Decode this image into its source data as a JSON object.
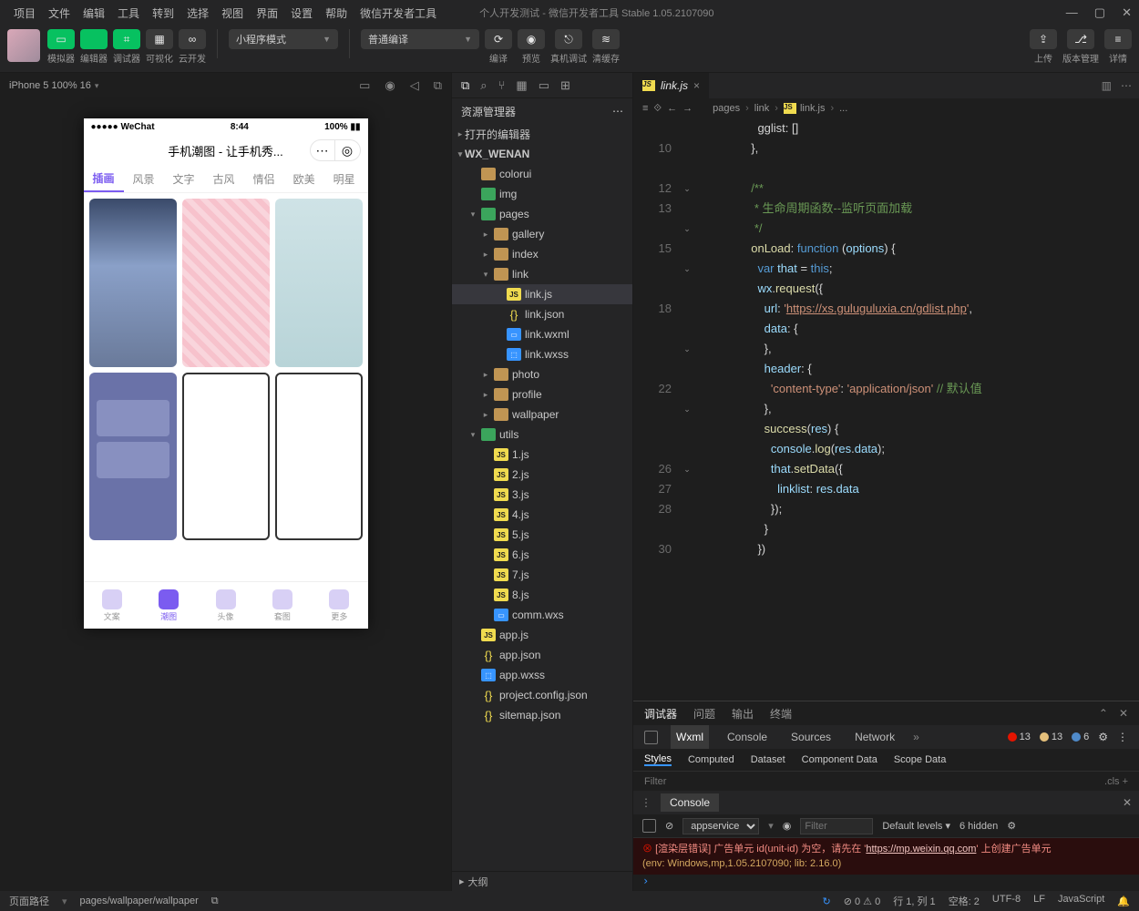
{
  "menubar": [
    "项目",
    "文件",
    "编辑",
    "工具",
    "转到",
    "选择",
    "视图",
    "界面",
    "设置",
    "帮助",
    "微信开发者工具"
  ],
  "window_title": "个人开发测试 - 微信开发者工具 Stable 1.05.2107090",
  "toolbar": {
    "groups": [
      {
        "label": "模拟器",
        "cls": "green",
        "glyph": "▭"
      },
      {
        "label": "编辑器",
        "cls": "green",
        "glyph": "</>"
      },
      {
        "label": "调试器",
        "cls": "green",
        "glyph": "⌗"
      },
      {
        "label": "可视化",
        "cls": "dark",
        "glyph": "▦"
      },
      {
        "label": "云开发",
        "cls": "dark",
        "glyph": "∞"
      }
    ],
    "mode": "小程序模式",
    "compile": "普通编译",
    "actions": [
      {
        "label": "编译",
        "glyph": "⟳"
      },
      {
        "label": "预览",
        "glyph": "◉"
      },
      {
        "label": "真机调试",
        "glyph": "⎋"
      },
      {
        "label": "清缓存",
        "glyph": "≋"
      }
    ],
    "right": [
      {
        "label": "上传",
        "glyph": "⇪"
      },
      {
        "label": "版本管理",
        "glyph": "⎇"
      },
      {
        "label": "详情",
        "glyph": "≡"
      }
    ]
  },
  "simulator": {
    "device": "iPhone 5 100% 16"
  },
  "phone": {
    "carrier": "●●●●● WeChat",
    "time": "8:44",
    "battery": "100%",
    "title": "手机潮图 - 让手机秀...",
    "tabs": [
      "插画",
      "风景",
      "文字",
      "古风",
      "情侣",
      "欧美",
      "明星"
    ],
    "tabbar": [
      "文案",
      "潮图",
      "头像",
      "套图",
      "更多"
    ],
    "tabbar_active": 1
  },
  "explorer": {
    "title": "资源管理器",
    "sections": [
      "打开的编辑器",
      "WX_WENAN"
    ],
    "tree": [
      {
        "d": 1,
        "t": "folder",
        "n": "colorui",
        "c": ""
      },
      {
        "d": 1,
        "t": "folder-g",
        "n": "img",
        "c": ""
      },
      {
        "d": 1,
        "t": "folder-g",
        "n": "pages",
        "c": "▾"
      },
      {
        "d": 2,
        "t": "folder",
        "n": "gallery",
        "c": "▸"
      },
      {
        "d": 2,
        "t": "folder",
        "n": "index",
        "c": "▸"
      },
      {
        "d": 2,
        "t": "folder",
        "n": "link",
        "c": "▾"
      },
      {
        "d": 3,
        "t": "js",
        "n": "link.js",
        "c": "",
        "sel": true
      },
      {
        "d": 3,
        "t": "json",
        "n": "link.json",
        "c": ""
      },
      {
        "d": 3,
        "t": "wxml",
        "n": "link.wxml",
        "c": ""
      },
      {
        "d": 3,
        "t": "wxss",
        "n": "link.wxss",
        "c": ""
      },
      {
        "d": 2,
        "t": "folder",
        "n": "photo",
        "c": "▸"
      },
      {
        "d": 2,
        "t": "folder",
        "n": "profile",
        "c": "▸"
      },
      {
        "d": 2,
        "t": "folder",
        "n": "wallpaper",
        "c": "▸"
      },
      {
        "d": 1,
        "t": "folder-g",
        "n": "utils",
        "c": "▾"
      },
      {
        "d": 2,
        "t": "js",
        "n": "1.js",
        "c": ""
      },
      {
        "d": 2,
        "t": "js",
        "n": "2.js",
        "c": ""
      },
      {
        "d": 2,
        "t": "js",
        "n": "3.js",
        "c": ""
      },
      {
        "d": 2,
        "t": "js",
        "n": "4.js",
        "c": ""
      },
      {
        "d": 2,
        "t": "js",
        "n": "5.js",
        "c": ""
      },
      {
        "d": 2,
        "t": "js",
        "n": "6.js",
        "c": ""
      },
      {
        "d": 2,
        "t": "js",
        "n": "7.js",
        "c": ""
      },
      {
        "d": 2,
        "t": "js",
        "n": "8.js",
        "c": ""
      },
      {
        "d": 2,
        "t": "wxml",
        "n": "comm.wxs",
        "c": ""
      },
      {
        "d": 1,
        "t": "js",
        "n": "app.js",
        "c": ""
      },
      {
        "d": 1,
        "t": "json",
        "n": "app.json",
        "c": ""
      },
      {
        "d": 1,
        "t": "wxss",
        "n": "app.wxss",
        "c": ""
      },
      {
        "d": 1,
        "t": "json",
        "n": "project.config.json",
        "c": ""
      },
      {
        "d": 1,
        "t": "json",
        "n": "sitemap.json",
        "c": ""
      }
    ],
    "outline": "大纲"
  },
  "editor": {
    "tab": "link.js",
    "crumb": [
      "pages",
      "link",
      "link.js",
      "..."
    ],
    "lines": [
      {
        "n": "",
        "html": "    gglist: []"
      },
      {
        "n": "10",
        "html": "  },"
      },
      {
        "n": "",
        "html": ""
      },
      {
        "n": "12",
        "html": "  <span class='c-com'>/**</span>"
      },
      {
        "n": "13",
        "html": "  <span class='c-com'> * 生命周期函数--监听页面加载</span>"
      },
      {
        "n": "",
        "html": "  <span class='c-com'> */</span>"
      },
      {
        "n": "15",
        "html": "  <span class='c-fn'>onLoad</span>: <span class='c-kw'>function</span> (<span class='c-var'>options</span>) {"
      },
      {
        "n": "",
        "html": "    <span class='c-kw'>var</span> <span class='c-var'>that</span> = <span class='c-kw'>this</span>;"
      },
      {
        "n": "",
        "html": "    <span class='c-var'>wx</span>.<span class='c-fn'>request</span>({"
      },
      {
        "n": "18",
        "html": "      <span class='c-prop'>url</span>: <span class='c-str'>'</span><span class='c-url'>https://xs.guluguluxia.cn/gdlist.php</span><span class='c-str'>'</span>,"
      },
      {
        "n": "",
        "html": "      <span class='c-prop'>data</span>: {"
      },
      {
        "n": "",
        "html": "      },"
      },
      {
        "n": "",
        "html": "      <span class='c-prop'>header</span>: {"
      },
      {
        "n": "22",
        "html": "        <span class='c-str'>'content-type'</span>: <span class='c-str'>'application/json'</span> <span class='c-com'>// 默认值</span>"
      },
      {
        "n": "",
        "html": "      },"
      },
      {
        "n": "",
        "html": "      <span class='c-fn'>success</span>(<span class='c-var'>res</span>) {"
      },
      {
        "n": "",
        "html": "        <span class='c-var'>console</span>.<span class='c-fn'>log</span>(<span class='c-var'>res</span>.<span class='c-var'>data</span>);"
      },
      {
        "n": "26",
        "html": "        <span class='c-var'>that</span>.<span class='c-fn'>setData</span>({"
      },
      {
        "n": "27",
        "html": "          <span class='c-prop'>linklist</span>: <span class='c-var'>res</span>.<span class='c-var'>data</span>"
      },
      {
        "n": "28",
        "html": "        });"
      },
      {
        "n": "",
        "html": "      }"
      },
      {
        "n": "30",
        "html": "    })"
      }
    ],
    "folds": {
      "3": "⌄",
      "5": "⌄",
      "7": "⌄",
      "11": "⌄",
      "14": "⌄",
      "17": "⌄"
    }
  },
  "devtools": {
    "tabs": [
      "调试器",
      "问题",
      "输出",
      "终端"
    ],
    "sub": [
      "Wxml",
      "Console",
      "Sources",
      "Network"
    ],
    "badges": {
      "err": "13",
      "warn": "13",
      "info": "6"
    },
    "styles": [
      "Styles",
      "Computed",
      "Dataset",
      "Component Data",
      "Scope Data"
    ],
    "filter": "Filter",
    "cls": ".cls",
    "console": {
      "title": "Console",
      "context": "appservice",
      "levels": "Default levels",
      "hidden": "6 hidden",
      "msg1": "[渲染层错误] 广告单元 id(unit-id) 为空，请先在 '",
      "msg1b": "' 上创建广告单元",
      "link": "https://mp.weixin.qq.com",
      "env": "(env: Windows,mp,1.05.2107090; lib: 2.16.0)"
    }
  },
  "status": {
    "l1": "页面路径",
    "l2": "pages/wallpaper/wallpaper",
    "err": "0",
    "warn": "0",
    "r": [
      "行 1, 列 1",
      "空格: 2",
      "UTF-8",
      "LF",
      "JavaScript"
    ]
  }
}
